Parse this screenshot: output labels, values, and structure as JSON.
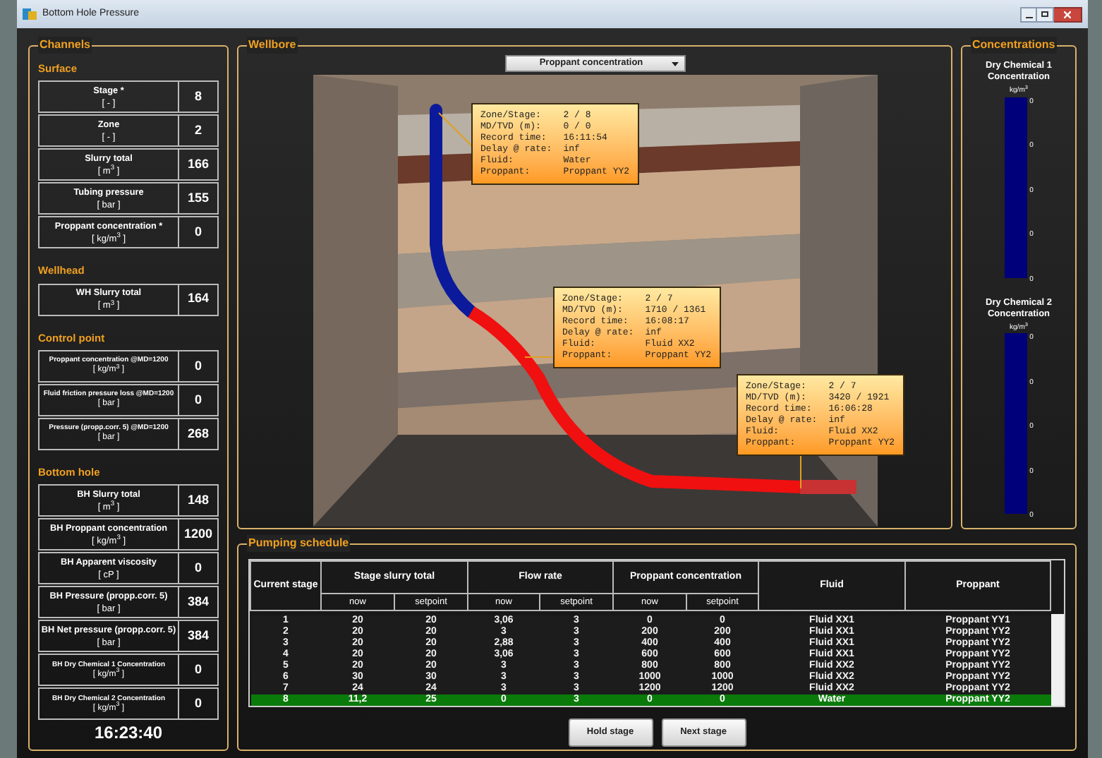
{
  "window": {
    "title": "Bottom Hole Pressure"
  },
  "channels": {
    "title": "Channels",
    "sections": [
      {
        "title": "Surface",
        "rows": [
          {
            "label": "Stage *",
            "unit": "[ - ]",
            "value": "8",
            "kind": "normal"
          },
          {
            "label": "Zone",
            "unit": "[ - ]",
            "value": "2",
            "kind": "normal"
          },
          {
            "label": "Slurry total",
            "unit": "[ m$^{3}$ ]",
            "value": "166",
            "kind": "normal"
          },
          {
            "label": "Tubing pressure",
            "unit": "[ bar ]",
            "value": "155",
            "kind": "normal"
          },
          {
            "label": "Proppant concentration *",
            "unit": "[ kg/m$^{3}$ ]",
            "value": "0",
            "kind": "normal"
          }
        ]
      },
      {
        "title": "Wellhead",
        "rows": [
          {
            "label": "WH Slurry total",
            "unit": "[ m$^{3}$ ]",
            "value": "164",
            "kind": "normal"
          }
        ]
      },
      {
        "title": "Control point",
        "rows": [
          {
            "label": "Proppant concentration  @MD=1200",
            "unit": "[ kg/m$^{3}$ ]",
            "value": "0",
            "kind": "compact"
          },
          {
            "label": "Fluid friction pressure loss  @MD=1200",
            "unit": "[ bar ]",
            "value": "0",
            "kind": "compact"
          },
          {
            "label": "Pressure (propp.corr. 5)  @MD=1200",
            "unit": "[ bar ]",
            "value": "268",
            "kind": "compact"
          }
        ]
      },
      {
        "title": "Bottom hole",
        "rows": [
          {
            "label": "BH Slurry total",
            "unit": "[ m$^{3}$ ]",
            "value": "148",
            "kind": "normal"
          },
          {
            "label": "BH Proppant concentration",
            "unit": "[ kg/m$^{3}$ ]",
            "value": "1200",
            "kind": "normal"
          },
          {
            "label": "BH Apparent viscosity",
            "unit": "[ cP ]",
            "value": "0",
            "kind": "normal"
          },
          {
            "label": "BH Pressure (propp.corr. 5)",
            "unit": "[ bar ]",
            "value": "384",
            "kind": "normal"
          },
          {
            "label": "BH Net pressure (propp.corr. 5)",
            "unit": "[ bar ]",
            "value": "384",
            "kind": "normal"
          },
          {
            "label": "BH Dry Chemical 1 Concentration",
            "unit": "[ kg/m$^{3}$ ]",
            "value": "0",
            "kind": "compact"
          },
          {
            "label": "BH Dry Chemical 2 Concentration",
            "unit": "[ kg/m$^{3}$ ]",
            "value": "0",
            "kind": "compact"
          }
        ]
      }
    ],
    "clock": "16:23:40"
  },
  "wellbore": {
    "title": "Wellbore",
    "dropdown": "Proppant concentration",
    "tooltips": [
      {
        "lines": [
          {
            "label": "Zone/Stage:",
            "value": "2 / 8"
          },
          {
            "label": "MD/TVD (m):",
            "value": "0 / 0"
          },
          {
            "label": "Record time:",
            "value": "16:11:54"
          },
          {
            "label": "Delay @ rate:",
            "value": "inf"
          },
          {
            "label": "Fluid:",
            "value": "Water"
          },
          {
            "label": "Proppant:",
            "value": "Proppant YY2"
          }
        ]
      },
      {
        "lines": [
          {
            "label": "Zone/Stage:",
            "value": "2 / 7"
          },
          {
            "label": "MD/TVD (m):",
            "value": "1710 / 1361"
          },
          {
            "label": "Record time:",
            "value": "16:08:17"
          },
          {
            "label": "Delay @ rate:",
            "value": "inf"
          },
          {
            "label": "Fluid:",
            "value": "Fluid XX2"
          },
          {
            "label": "Proppant:",
            "value": "Proppant YY2"
          }
        ]
      },
      {
        "lines": [
          {
            "label": "Zone/Stage:",
            "value": "2 / 7"
          },
          {
            "label": "MD/TVD (m):",
            "value": "3420 / 1921"
          },
          {
            "label": "Record time:",
            "value": "16:06:28"
          },
          {
            "label": "Delay @ rate:",
            "value": "inf"
          },
          {
            "label": "Fluid:",
            "value": "Fluid XX2"
          },
          {
            "label": "Proppant:",
            "value": "Proppant YY2"
          }
        ]
      }
    ]
  },
  "concentrations": {
    "title": "Concentrations",
    "gauges": [
      {
        "title": "Dry Chemical 1 Concentration",
        "unit": "kg/m$^{3}$",
        "ticks": [
          "0",
          "0",
          "0",
          "0",
          "0"
        ]
      },
      {
        "title": "Dry Chemical 2 Concentration",
        "unit": "kg/m$^{3}$",
        "ticks": [
          "0",
          "0",
          "0",
          "0",
          "0"
        ]
      }
    ]
  },
  "schedule": {
    "title": "Pumping schedule",
    "header": {
      "current": "Current stage",
      "groups": [
        "Stage slurry total",
        "Flow rate",
        "Proppant concentration"
      ],
      "sub": [
        "now",
        "setpoint",
        "now",
        "setpoint",
        "now",
        "setpoint"
      ],
      "fluid": "Fluid",
      "proppant": "Proppant"
    },
    "rows": [
      {
        "cells": [
          "1",
          "20",
          "20",
          "3,06",
          "3",
          "0",
          "0",
          "Fluid XX1",
          "Proppant YY1"
        ],
        "selected": false
      },
      {
        "cells": [
          "2",
          "20",
          "20",
          "3",
          "3",
          "200",
          "200",
          "Fluid XX1",
          "Proppant YY2"
        ],
        "selected": false
      },
      {
        "cells": [
          "3",
          "20",
          "20",
          "2,88",
          "3",
          "400",
          "400",
          "Fluid XX1",
          "Proppant YY2"
        ],
        "selected": false
      },
      {
        "cells": [
          "4",
          "20",
          "20",
          "3,06",
          "3",
          "600",
          "600",
          "Fluid XX1",
          "Proppant YY2"
        ],
        "selected": false
      },
      {
        "cells": [
          "5",
          "20",
          "20",
          "3",
          "3",
          "800",
          "800",
          "Fluid XX2",
          "Proppant YY2"
        ],
        "selected": false
      },
      {
        "cells": [
          "6",
          "30",
          "30",
          "3",
          "3",
          "1000",
          "1000",
          "Fluid XX2",
          "Proppant YY2"
        ],
        "selected": false
      },
      {
        "cells": [
          "7",
          "24",
          "24",
          "3",
          "3",
          "1200",
          "1200",
          "Fluid XX2",
          "Proppant YY2"
        ],
        "selected": false
      },
      {
        "cells": [
          "8",
          "11,2",
          "25",
          "0",
          "3",
          "0",
          "0",
          "Water",
          "Proppant YY2"
        ],
        "selected": true
      }
    ],
    "buttons": [
      "Hold stage",
      "Next stage"
    ]
  }
}
